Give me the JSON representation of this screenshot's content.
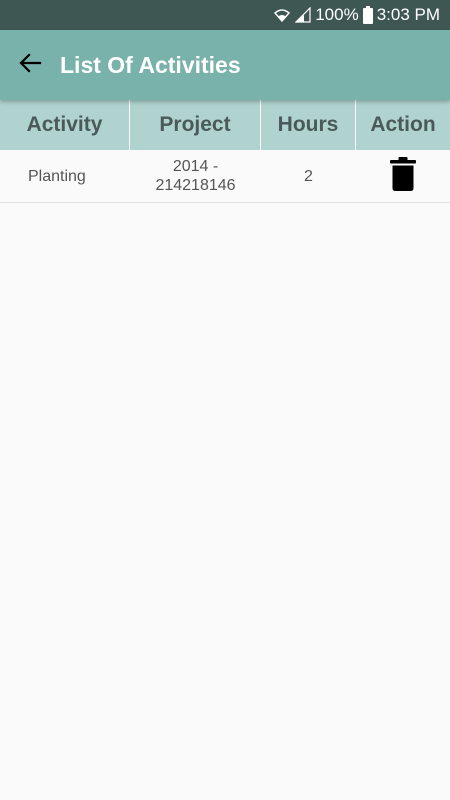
{
  "status_bar": {
    "battery": "100%",
    "time": "3:03 PM"
  },
  "app_bar": {
    "title": "List Of Activities",
    "back_icon": "arrow-left-icon"
  },
  "table": {
    "headers": [
      "Activity",
      "Project",
      "Hours",
      "Action"
    ],
    "rows": [
      {
        "activity": "Planting",
        "project_line1": "2014 -",
        "project_line2": "214218146",
        "hours": "2",
        "action_icon": "trash-icon"
      }
    ]
  },
  "colors": {
    "status_bar": "#3f5753",
    "app_bar": "#79b1ab",
    "table_header": "#b0d3cf",
    "background": "#fafafa"
  }
}
